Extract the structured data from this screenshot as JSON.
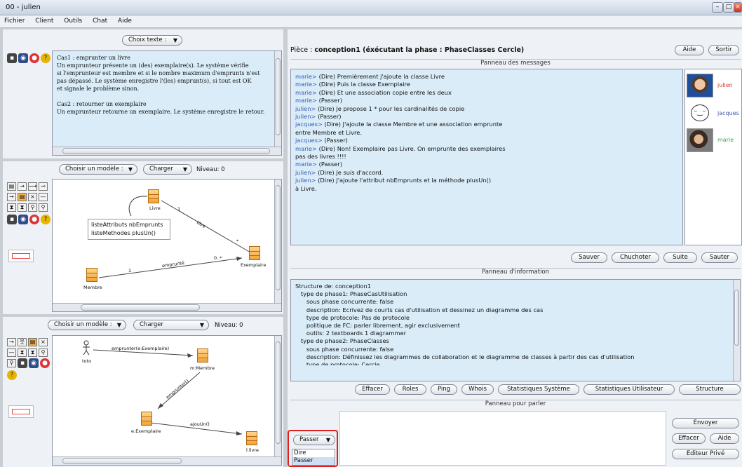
{
  "window": {
    "title": "00 - julien"
  },
  "menu": [
    "Fichier",
    "Client",
    "Outils",
    "Chat",
    "Aide"
  ],
  "left": {
    "text_panel": {
      "choose_text_label": "Choix texte :",
      "cases": [
        {
          "title": "Cas1 : emprunter un livre",
          "lines": [
            "Un emprunteur présente un (des) exemplaire(s). Le système vérifie",
            "si l'emprunteur est membre et si le nombre maximum d'emprunts n'est",
            "pas dépassé. Le système enregistre l'(les) emprunt(s), si tout est OK",
            "et signale le problème sinon."
          ]
        },
        {
          "title": "Cas2 : retourner un exemplaire",
          "lines": [
            "Un emprunteur retourne un exemplaire. Le système enregistre le retour."
          ]
        }
      ]
    },
    "diagram1": {
      "choose_model_label": "Choisir un modèle :",
      "load_label": "Charger",
      "level_label": "Niveau: 0",
      "classes": {
        "livre": "Livre",
        "exemplaire": "Exemplaire",
        "membre": "Membre"
      },
      "edge_labels": {
        "title": "titre",
        "one_a": "1",
        "star_a": "*",
        "empruntee": "emprunté",
        "one_b": "1",
        "zero_star": "0..*"
      },
      "tooltip": [
        "listeAttributs nbEmprunts",
        "listeMethodes plusUn()"
      ]
    },
    "diagram2": {
      "choose_model_label": "Choisir un modèle :",
      "load_label": "Charger",
      "level_label": "Niveau: 0",
      "actor": "toto",
      "objects": {
        "membre": "m:Membre",
        "exemplaire": "e:Exemplaire",
        "livre": "l:livre"
      },
      "messages": {
        "m1": "emprunter(e:Exemplaire)",
        "m2": "emprunter()",
        "m3": "ajouUn()"
      }
    }
  },
  "right": {
    "room_prefix": "Pièce : ",
    "room_title": "conception1 (éxécutant la phase : PhaseClasses Cercle)",
    "help_label": "Aide",
    "exit_label": "Sortir",
    "messages_panel_title": "Panneau des messages",
    "messages": [
      {
        "who": "marie>",
        "text": " (Dire) Premièrement j'ajoute la classe Livre"
      },
      {
        "who": "marie>",
        "text": " (Dire) Puis la classe Exemplaire"
      },
      {
        "who": "marie>",
        "text": " (Dire) Et une association copie entre les deux"
      },
      {
        "who": "marie>",
        "text": " (Passer)"
      },
      {
        "who": "julien>",
        "text": " (Dire) Je propose 1 * pour les cardinalités de copie"
      },
      {
        "who": "julien>",
        "text": " (Passer)"
      },
      {
        "who": "jacques>",
        "text": " (Dire) J'ajoute la classe Membre et une association emprunte"
      },
      {
        "who": "",
        "text": "entre Membre et Livre."
      },
      {
        "who": "jacques>",
        "text": " (Passer)"
      },
      {
        "who": "marie>",
        "text": " (Dire) Non! Exemplaire pas Livre. On emprunte des exemplaires"
      },
      {
        "who": "",
        "text": "pas des livres !!!!"
      },
      {
        "who": "marie>",
        "text": " (Passer)"
      },
      {
        "who": "julien>",
        "text": " (Dire) Je suis d'accord."
      },
      {
        "who": "julien>",
        "text": " (Dire) J'ajoute l'attribut nbEmprunts et la méthode plusUn()"
      },
      {
        "who": "",
        "text": "à Livre."
      }
    ],
    "users": [
      {
        "name": "julien",
        "color": "#d23a2a"
      },
      {
        "name": "jacques",
        "color": "#3a5bb0"
      },
      {
        "name": "marie",
        "color": "#3aa84a"
      }
    ],
    "message_buttons": [
      "Sauver",
      "Chuchoter",
      "Suite",
      "Sauter"
    ],
    "info_panel_title": "Panneau d'information",
    "info_lines": [
      "Structure de: conception1",
      "   type de phase1: PhaseCasUtilisation",
      "      sous phase concurrente: false",
      "      description: Ecrivez de courts cas d'utilisation et dessinez un diagramme des cas",
      "      type de protocole: Pas de protocole",
      "      politique de FC: parler librement, agir exclusivement",
      "      outils: 2 textboards 1 diagrammer",
      "   type de phase2: PhaseClasses",
      "      sous phase concurrente: false",
      "      description: Définissez les diagrammes de collaboration et le diagramme de classes à partir des cas d'utilisation",
      "      type de protocole: Cercle"
    ],
    "info_buttons": [
      "Effacer",
      "Roles",
      "Ping",
      "Whois",
      "Statistiques Système",
      "Statistiques Utilisateur",
      "Structure"
    ],
    "talk_panel_title": "Panneau pour parler",
    "talk_select": "Passer",
    "talk_options": [
      "Dire",
      "Passer"
    ],
    "send_label": "Envoyer",
    "clear_label": "Effacer",
    "help2_label": "Aide",
    "private_editor_label": "Editeur Privé"
  }
}
